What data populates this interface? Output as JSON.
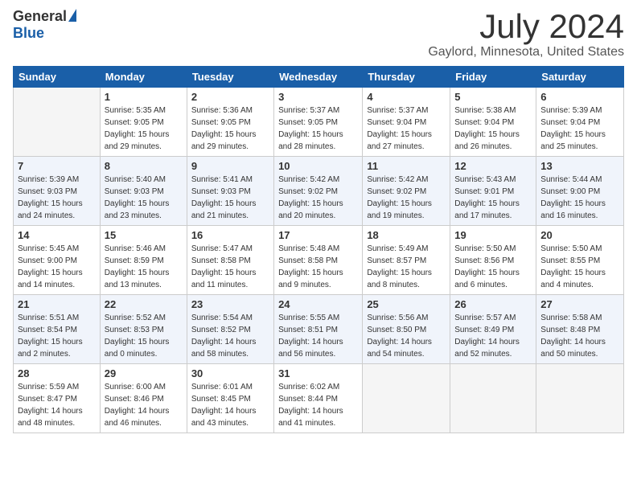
{
  "header": {
    "logo_general": "General",
    "logo_blue": "Blue",
    "month": "July 2024",
    "location": "Gaylord, Minnesota, United States"
  },
  "weekdays": [
    "Sunday",
    "Monday",
    "Tuesday",
    "Wednesday",
    "Thursday",
    "Friday",
    "Saturday"
  ],
  "weeks": [
    [
      {
        "day": "",
        "info": ""
      },
      {
        "day": "1",
        "info": "Sunrise: 5:35 AM\nSunset: 9:05 PM\nDaylight: 15 hours\nand 29 minutes."
      },
      {
        "day": "2",
        "info": "Sunrise: 5:36 AM\nSunset: 9:05 PM\nDaylight: 15 hours\nand 29 minutes."
      },
      {
        "day": "3",
        "info": "Sunrise: 5:37 AM\nSunset: 9:05 PM\nDaylight: 15 hours\nand 28 minutes."
      },
      {
        "day": "4",
        "info": "Sunrise: 5:37 AM\nSunset: 9:04 PM\nDaylight: 15 hours\nand 27 minutes."
      },
      {
        "day": "5",
        "info": "Sunrise: 5:38 AM\nSunset: 9:04 PM\nDaylight: 15 hours\nand 26 minutes."
      },
      {
        "day": "6",
        "info": "Sunrise: 5:39 AM\nSunset: 9:04 PM\nDaylight: 15 hours\nand 25 minutes."
      }
    ],
    [
      {
        "day": "7",
        "info": "Sunrise: 5:39 AM\nSunset: 9:03 PM\nDaylight: 15 hours\nand 24 minutes."
      },
      {
        "day": "8",
        "info": "Sunrise: 5:40 AM\nSunset: 9:03 PM\nDaylight: 15 hours\nand 23 minutes."
      },
      {
        "day": "9",
        "info": "Sunrise: 5:41 AM\nSunset: 9:03 PM\nDaylight: 15 hours\nand 21 minutes."
      },
      {
        "day": "10",
        "info": "Sunrise: 5:42 AM\nSunset: 9:02 PM\nDaylight: 15 hours\nand 20 minutes."
      },
      {
        "day": "11",
        "info": "Sunrise: 5:42 AM\nSunset: 9:02 PM\nDaylight: 15 hours\nand 19 minutes."
      },
      {
        "day": "12",
        "info": "Sunrise: 5:43 AM\nSunset: 9:01 PM\nDaylight: 15 hours\nand 17 minutes."
      },
      {
        "day": "13",
        "info": "Sunrise: 5:44 AM\nSunset: 9:00 PM\nDaylight: 15 hours\nand 16 minutes."
      }
    ],
    [
      {
        "day": "14",
        "info": "Sunrise: 5:45 AM\nSunset: 9:00 PM\nDaylight: 15 hours\nand 14 minutes."
      },
      {
        "day": "15",
        "info": "Sunrise: 5:46 AM\nSunset: 8:59 PM\nDaylight: 15 hours\nand 13 minutes."
      },
      {
        "day": "16",
        "info": "Sunrise: 5:47 AM\nSunset: 8:58 PM\nDaylight: 15 hours\nand 11 minutes."
      },
      {
        "day": "17",
        "info": "Sunrise: 5:48 AM\nSunset: 8:58 PM\nDaylight: 15 hours\nand 9 minutes."
      },
      {
        "day": "18",
        "info": "Sunrise: 5:49 AM\nSunset: 8:57 PM\nDaylight: 15 hours\nand 8 minutes."
      },
      {
        "day": "19",
        "info": "Sunrise: 5:50 AM\nSunset: 8:56 PM\nDaylight: 15 hours\nand 6 minutes."
      },
      {
        "day": "20",
        "info": "Sunrise: 5:50 AM\nSunset: 8:55 PM\nDaylight: 15 hours\nand 4 minutes."
      }
    ],
    [
      {
        "day": "21",
        "info": "Sunrise: 5:51 AM\nSunset: 8:54 PM\nDaylight: 15 hours\nand 2 minutes."
      },
      {
        "day": "22",
        "info": "Sunrise: 5:52 AM\nSunset: 8:53 PM\nDaylight: 15 hours\nand 0 minutes."
      },
      {
        "day": "23",
        "info": "Sunrise: 5:54 AM\nSunset: 8:52 PM\nDaylight: 14 hours\nand 58 minutes."
      },
      {
        "day": "24",
        "info": "Sunrise: 5:55 AM\nSunset: 8:51 PM\nDaylight: 14 hours\nand 56 minutes."
      },
      {
        "day": "25",
        "info": "Sunrise: 5:56 AM\nSunset: 8:50 PM\nDaylight: 14 hours\nand 54 minutes."
      },
      {
        "day": "26",
        "info": "Sunrise: 5:57 AM\nSunset: 8:49 PM\nDaylight: 14 hours\nand 52 minutes."
      },
      {
        "day": "27",
        "info": "Sunrise: 5:58 AM\nSunset: 8:48 PM\nDaylight: 14 hours\nand 50 minutes."
      }
    ],
    [
      {
        "day": "28",
        "info": "Sunrise: 5:59 AM\nSunset: 8:47 PM\nDaylight: 14 hours\nand 48 minutes."
      },
      {
        "day": "29",
        "info": "Sunrise: 6:00 AM\nSunset: 8:46 PM\nDaylight: 14 hours\nand 46 minutes."
      },
      {
        "day": "30",
        "info": "Sunrise: 6:01 AM\nSunset: 8:45 PM\nDaylight: 14 hours\nand 43 minutes."
      },
      {
        "day": "31",
        "info": "Sunrise: 6:02 AM\nSunset: 8:44 PM\nDaylight: 14 hours\nand 41 minutes."
      },
      {
        "day": "",
        "info": ""
      },
      {
        "day": "",
        "info": ""
      },
      {
        "day": "",
        "info": ""
      }
    ]
  ]
}
